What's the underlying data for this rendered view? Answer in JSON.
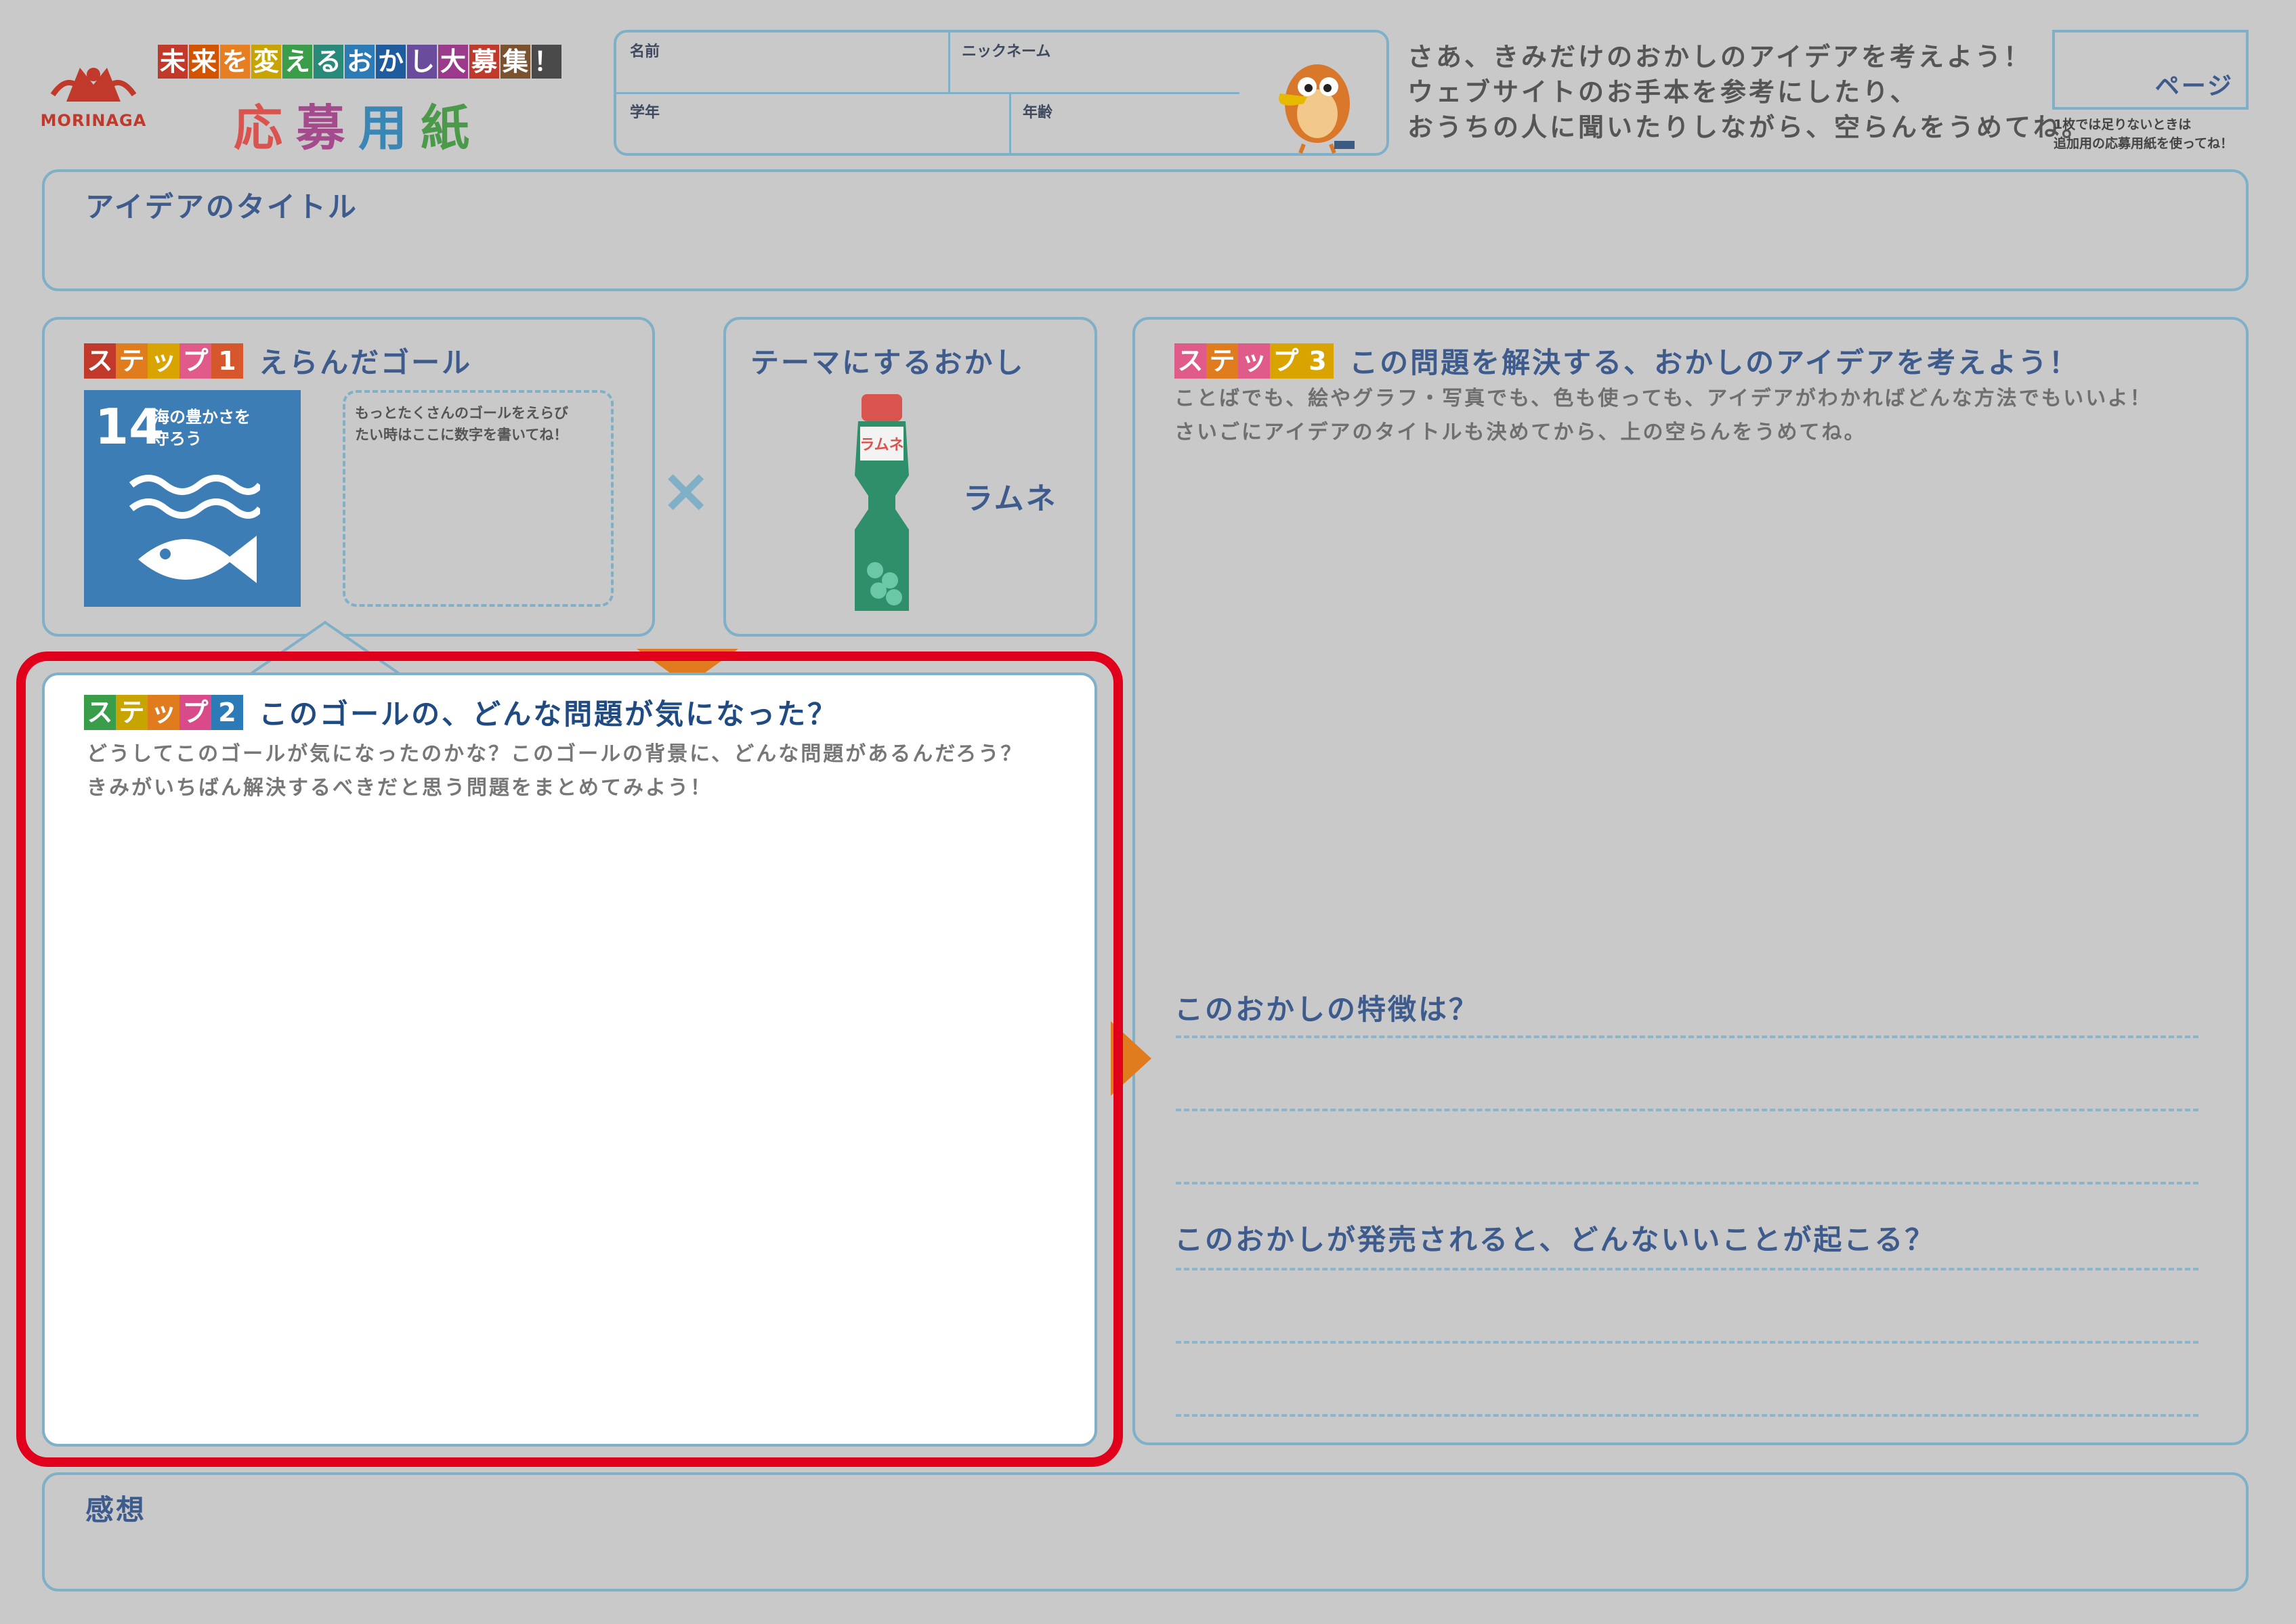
{
  "header": {
    "brand": "MORINAGA",
    "campaign": [
      "未",
      "来",
      "を",
      "変",
      "え",
      "る",
      "お",
      "か",
      "し",
      "大",
      "募",
      "集",
      "！"
    ],
    "campaign_colors": [
      "#c0392b",
      "#d35400",
      "#e67e22",
      "#c8a400",
      "#3a9d4a",
      "#2a8a7a",
      "#2c7bb6",
      "#1f5c9e",
      "#6a4c9c",
      "#9b3a8a",
      "#c0392b",
      "#7a5230",
      "#4a4a4a"
    ],
    "form_title": [
      "応",
      "募",
      "用",
      "紙"
    ],
    "form_title_colors": [
      "#d9534f",
      "#a54a8c",
      "#3a86b4",
      "#4a9a4a"
    ],
    "fields": {
      "name": "名前",
      "nickname": "ニックネーム",
      "grade": "学年",
      "age": "年齢"
    },
    "intro": [
      "さあ、きみだけのおかしのアイデアを考えよう！",
      "ウェブサイトのお手本を参考にしたり、",
      "おうちの人に聞いたりしながら、空らんをうめてね。"
    ],
    "page_label": "ページ",
    "page_note": [
      "1枚では足りないときは",
      "追加用の応募用紙を使ってね！"
    ]
  },
  "idea_title": {
    "label": "アイデアのタイトル"
  },
  "step1": {
    "badge": [
      "ス",
      "テ",
      "ッ",
      "プ",
      "1"
    ],
    "badge_colors": [
      "#c0392b",
      "#e07b1e",
      "#d9a400",
      "#e05a8a",
      "#d6572b"
    ],
    "heading": "えらんだゴール",
    "goal_number": "14",
    "goal_text": [
      "海の豊かさを",
      "守ろう"
    ],
    "goal_color": "#3b7db4",
    "extra_hint": [
      "もっとたくさんのゴールをえらび",
      "たい時はここに数字を書いてね！"
    ]
  },
  "times_symbol": "×",
  "theme": {
    "heading": "テーマにするおかし",
    "product_name": "ラムネ",
    "bottle_label": "ラムネ"
  },
  "step2": {
    "badge": [
      "ス",
      "テ",
      "ッ",
      "プ",
      "2"
    ],
    "badge_colors": [
      "#3a9d4a",
      "#c8a400",
      "#e07b1e",
      "#d94a8a",
      "#2c7bb6"
    ],
    "heading": "このゴールの、どんな問題が気になった？",
    "desc": [
      "どうしてこのゴールが気になったのかな？このゴールの背景に、どんな問題があるんだろう？",
      "きみがいちばん解決するべきだと思う問題をまとめてみよう！"
    ]
  },
  "step3": {
    "badge": [
      "ス",
      "テ",
      "ッ",
      "プ",
      "3"
    ],
    "badge_colors": [
      "#e05a8a",
      "#e07b1e",
      "#e05a8a",
      "#d9a400",
      "#d9a400"
    ],
    "heading": "この問題を解決する、おかしのアイデアを考えよう！",
    "desc": [
      "ことばでも、絵やグラフ・写真でも、色も使っても、アイデアがわかればどんな方法でもいいよ！",
      "さいごにアイデアのタイトルも決めてから、上の空らんをうめてね。"
    ],
    "q1": "このおかしの特徴は？",
    "q2": "このおかしが発売されると、どんないいことが起こる？"
  },
  "impression": {
    "label": "感想"
  },
  "colors": {
    "highlight": "#e0001b",
    "frame": "#7fb0c8",
    "heading": "#3d5b8c",
    "arrow": "#e07b1e"
  }
}
